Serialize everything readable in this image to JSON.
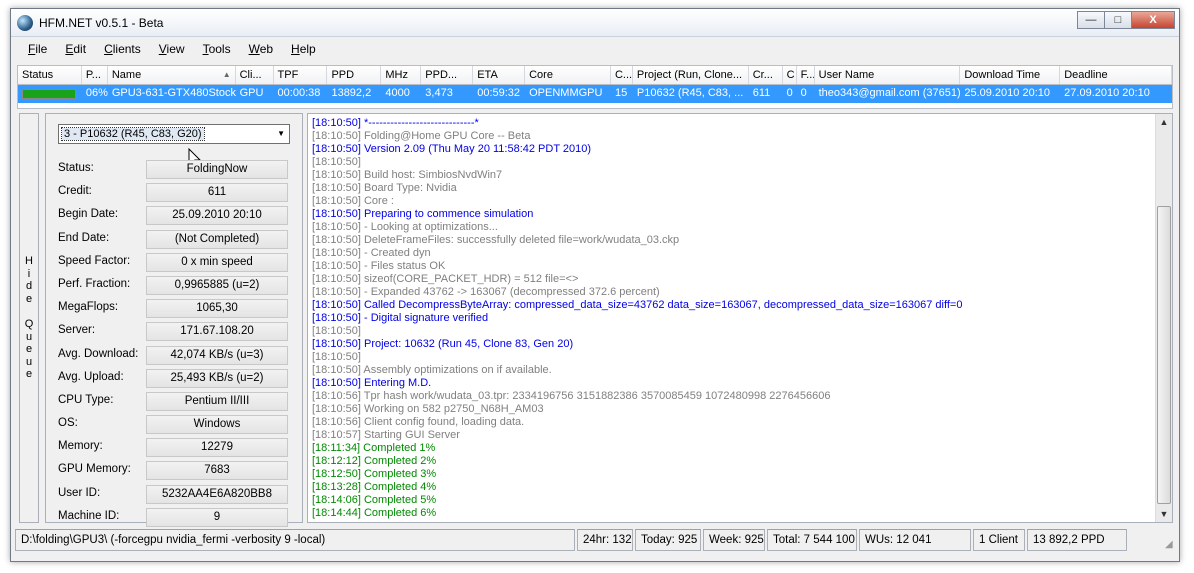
{
  "window": {
    "title": "HFM.NET v0.5.1 - Beta",
    "buttons": {
      "minimize": "—",
      "maximize": "□",
      "close": "X"
    }
  },
  "menu": [
    {
      "label": "File",
      "mn": "F",
      "rest": "ile"
    },
    {
      "label": "Edit",
      "mn": "E",
      "rest": "dit"
    },
    {
      "label": "Clients",
      "mn": "C",
      "rest": "lients"
    },
    {
      "label": "View",
      "mn": "V",
      "rest": "iew"
    },
    {
      "label": "Tools",
      "mn": "T",
      "rest": "ools"
    },
    {
      "label": "Web",
      "mn": "W",
      "rest": "eb"
    },
    {
      "label": "Help",
      "mn": "H",
      "rest": "elp"
    }
  ],
  "grid": {
    "columns": [
      "Status",
      "P...",
      "Name",
      "Cli...",
      "TPF",
      "PPD",
      "MHz",
      "PPD...",
      "ETA",
      "Core",
      "C...",
      "Project (Run, Clone...",
      "Cr...",
      "C",
      "F...",
      "User Name",
      "Download Time",
      "Deadline"
    ],
    "row": {
      "progress": 0.06,
      "cells": [
        "06%",
        "GPU3-631-GTX480Stock",
        "GPU",
        "00:00:38",
        "13892,2",
        "4000",
        "3,473",
        "00:59:32",
        "OPENMMGPU",
        "15",
        "P10632 (R45, C83, ...",
        "611",
        "0",
        "0",
        "theo343@gmail.com (37651)",
        "25.09.2010 20:10",
        "27.09.2010 20:10"
      ]
    }
  },
  "hide_queue_label": "Hide Queue",
  "queue": {
    "selected": "3 - P10632 (R45, C83, G20)",
    "fields": [
      {
        "label": "Status:",
        "value": "FoldingNow"
      },
      {
        "label": "Credit:",
        "value": "611"
      },
      {
        "label": "Begin Date:",
        "value": "25.09.2010 20:10"
      },
      {
        "label": "End Date:",
        "value": "(Not Completed)"
      },
      {
        "label": "Speed Factor:",
        "value": "0 x min speed"
      },
      {
        "label": "Perf. Fraction:",
        "value": "0,9965885 (u=2)"
      },
      {
        "label": "MegaFlops:",
        "value": "1065,30"
      },
      {
        "label": "Server:",
        "value": "171.67.108.20"
      },
      {
        "label": "Avg. Download:",
        "value": "42,074 KB/s (u=3)"
      },
      {
        "label": "Avg. Upload:",
        "value": "25,493 KB/s (u=2)"
      },
      {
        "label": "CPU Type:",
        "value": "Pentium II/III"
      },
      {
        "label": "OS:",
        "value": "Windows"
      },
      {
        "label": "Memory:",
        "value": "12279"
      },
      {
        "label": "GPU Memory:",
        "value": "7683"
      },
      {
        "label": "User ID:",
        "value": "5232AA4E6A820BB8"
      },
      {
        "label": "Machine ID:",
        "value": "9"
      }
    ]
  },
  "colors": {
    "selection": "#3399ff",
    "log_gray": "#808080",
    "log_blue": "#0000e6",
    "log_green": "#008a00",
    "progress_fill": "#1aa31a"
  },
  "log": [
    {
      "c": "blue",
      "t": "[18:10:50] *-----------------------------*"
    },
    {
      "c": "gray",
      "t": "[18:10:50] Folding@Home GPU Core -- Beta"
    },
    {
      "c": "blue",
      "t": "[18:10:50] Version 2.09 (Thu May 20 11:58:42 PDT 2010)"
    },
    {
      "c": "gray",
      "t": "[18:10:50]"
    },
    {
      "c": "gray",
      "t": "[18:10:50] Build host: SimbiosNvdWin7"
    },
    {
      "c": "gray",
      "t": "[18:10:50] Board Type: Nvidia"
    },
    {
      "c": "gray",
      "t": "[18:10:50] Core      :"
    },
    {
      "c": "blue",
      "t": "[18:10:50] Preparing to commence simulation"
    },
    {
      "c": "gray",
      "t": "[18:10:50] - Looking at optimizations..."
    },
    {
      "c": "gray",
      "t": "[18:10:50] DeleteFrameFiles: successfully deleted file=work/wudata_03.ckp"
    },
    {
      "c": "gray",
      "t": "[18:10:50] - Created dyn"
    },
    {
      "c": "gray",
      "t": "[18:10:50] - Files status OK"
    },
    {
      "c": "gray",
      "t": "[18:10:50] sizeof(CORE_PACKET_HDR) = 512 file=<>"
    },
    {
      "c": "gray",
      "t": "[18:10:50] - Expanded 43762 -> 163067 (decompressed 372.6 percent)"
    },
    {
      "c": "blue",
      "t": "[18:10:50] Called DecompressByteArray: compressed_data_size=43762 data_size=163067, decompressed_data_size=163067 diff=0"
    },
    {
      "c": "blue",
      "t": "[18:10:50] - Digital signature verified"
    },
    {
      "c": "gray",
      "t": "[18:10:50]"
    },
    {
      "c": "blue",
      "t": "[18:10:50] Project: 10632 (Run 45, Clone 83, Gen 20)"
    },
    {
      "c": "gray",
      "t": "[18:10:50]"
    },
    {
      "c": "gray",
      "t": "[18:10:50] Assembly optimizations on if available."
    },
    {
      "c": "blue",
      "t": "[18:10:50] Entering M.D."
    },
    {
      "c": "gray",
      "t": "[18:10:56] Tpr hash work/wudata_03.tpr:  2334196756 3151882386 3570085459 1072480998 2276456606"
    },
    {
      "c": "gray",
      "t": "[18:10:56] Working on 582 p2750_N68H_AM03"
    },
    {
      "c": "gray",
      "t": "[18:10:56] Client config found, loading data."
    },
    {
      "c": "gray",
      "t": "[18:10:57] Starting GUI Server"
    },
    {
      "c": "green",
      "t": "[18:11:34] Completed 1%"
    },
    {
      "c": "green",
      "t": "[18:12:12] Completed 2%"
    },
    {
      "c": "green",
      "t": "[18:12:50] Completed 3%"
    },
    {
      "c": "green",
      "t": "[18:13:28] Completed 4%"
    },
    {
      "c": "green",
      "t": "[18:14:06] Completed 5%"
    },
    {
      "c": "green",
      "t": "[18:14:44] Completed 6%"
    }
  ],
  "statusbar": {
    "path": "D:\\folding\\GPU3\\ (-forcegpu nvidia_fermi -verbosity 9 -local)",
    "hr24": "24hr: 132",
    "today": "Today: 925",
    "week": "Week: 925",
    "total": "Total: 7 544 100",
    "wus": "WUs: 12 041",
    "clients": "1 Client",
    "ppd": "13 892,2 PPD"
  }
}
